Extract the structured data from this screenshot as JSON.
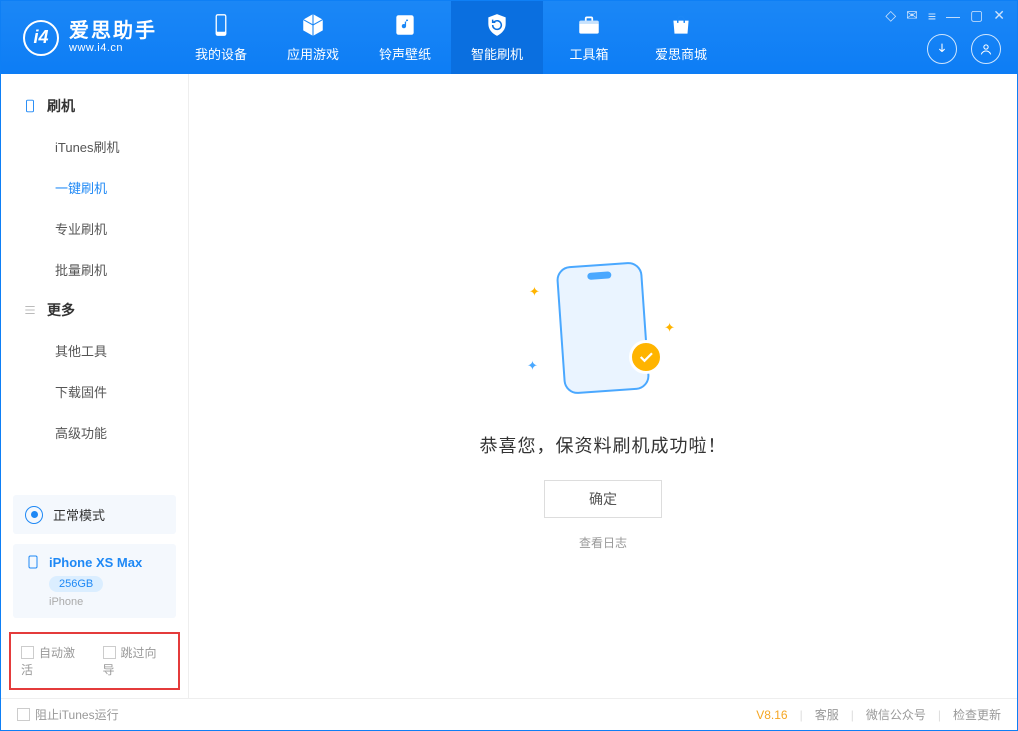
{
  "app": {
    "title": "爱思助手",
    "subtitle": "www.i4.cn"
  },
  "nav": {
    "device": "我的设备",
    "apps": "应用游戏",
    "ringtones": "铃声壁纸",
    "flash": "智能刷机",
    "toolbox": "工具箱",
    "store": "爱思商城"
  },
  "sidebar": {
    "group1": "刷机",
    "items1": {
      "itunes": "iTunes刷机",
      "oneclick": "一键刷机",
      "pro": "专业刷机",
      "batch": "批量刷机"
    },
    "group2": "更多",
    "items2": {
      "other": "其他工具",
      "firmware": "下载固件",
      "advanced": "高级功能"
    }
  },
  "status": {
    "mode": "正常模式"
  },
  "device": {
    "name": "iPhone XS Max",
    "capacity": "256GB",
    "type": "iPhone"
  },
  "options": {
    "auto_activate": "自动激活",
    "skip_guide": "跳过向导"
  },
  "main": {
    "success_msg": "恭喜您，保资料刷机成功啦！",
    "ok": "确定",
    "view_log": "查看日志"
  },
  "footer": {
    "block_itunes": "阻止iTunes运行",
    "version": "V8.16",
    "support": "客服",
    "wechat": "微信公众号",
    "update": "检查更新"
  }
}
